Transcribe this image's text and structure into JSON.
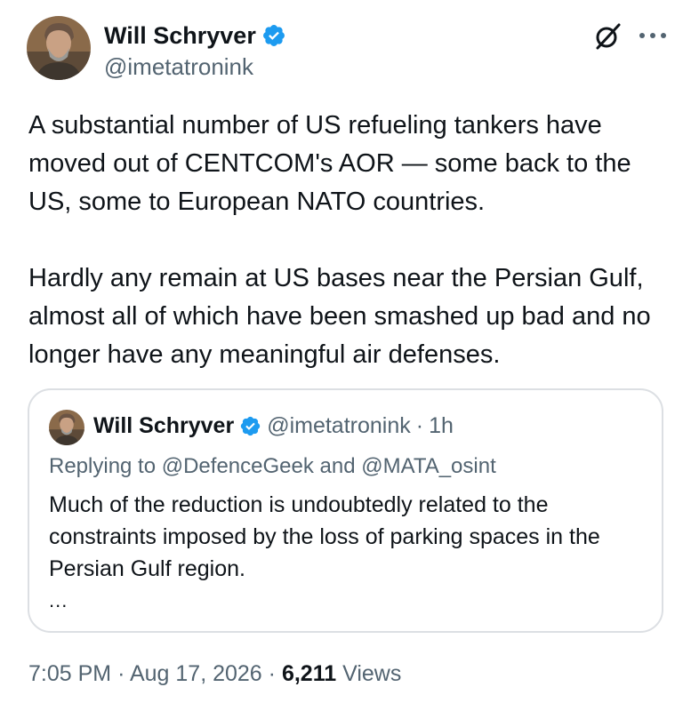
{
  "author": {
    "display_name": "Will Schryver",
    "handle": "@imetatronink",
    "verified": true
  },
  "body": {
    "paragraph_1": "A substantial number of US refueling tankers have moved out of CENTCOM's AOR — some back to the US, some to European NATO countries.",
    "paragraph_2": "Hardly any remain at US bases near the Persian Gulf, almost all of which have been smashed up bad and no longer have any meaningful air defenses."
  },
  "quote": {
    "display_name": "Will Schryver",
    "handle": "@imetatronink",
    "separator": "·",
    "time_ago": "1h",
    "replying_to": "Replying to @DefenceGeek and @MATA_osint",
    "text": "Much of the reduction is undoubtedly related to the constraints imposed by the loss of parking spaces in the Persian Gulf region.",
    "truncation": "..."
  },
  "meta": {
    "time": "7:05 PM",
    "date": "Aug 17, 2026",
    "separator": "·",
    "views_count": "6,211",
    "views_label": "Views"
  },
  "icons": {
    "verified": "verified-badge-icon",
    "grok": "grok-icon",
    "more": "more-options-icon"
  },
  "colors": {
    "verified_blue": "#1d9bf0",
    "secondary_text": "#536471",
    "primary_text": "#0f1419",
    "border": "#dcdfe3"
  }
}
